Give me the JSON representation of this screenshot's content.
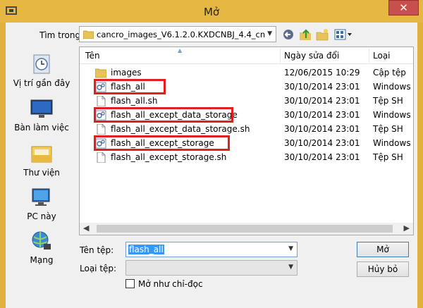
{
  "window": {
    "title": "Mở",
    "close_label": "✕"
  },
  "toolbar": {
    "look_in_label": "Tìm trong:",
    "path": "cancro_images_V6.1.2.0.KXDCNBJ_4.4_cn"
  },
  "places": [
    {
      "label": "Vị trí gần đây",
      "icon": "recent-places-icon"
    },
    {
      "label": "Bàn làm việc",
      "icon": "desktop-icon"
    },
    {
      "label": "Thư viện",
      "icon": "libraries-icon"
    },
    {
      "label": "PC này",
      "icon": "this-pc-icon"
    },
    {
      "label": "Mạng",
      "icon": "network-icon"
    }
  ],
  "columns": {
    "name": "Tên",
    "date": "Ngày sửa đổi",
    "type": "Loại"
  },
  "files": [
    {
      "name": "images",
      "date": "12/06/2015 10:29",
      "type": "Cập tệp",
      "icon": "folder-icon",
      "highlighted": false
    },
    {
      "name": "flash_all",
      "date": "30/10/2014 23:01",
      "type": "Windows",
      "icon": "batch-file-icon",
      "highlighted": true
    },
    {
      "name": "flash_all.sh",
      "date": "30/10/2014 23:01",
      "type": "Tệp SH",
      "icon": "document-icon",
      "highlighted": false
    },
    {
      "name": "flash_all_except_data_storage",
      "date": "30/10/2014 23:01",
      "type": "Windows",
      "icon": "batch-file-icon",
      "highlighted": true
    },
    {
      "name": "flash_all_except_data_storage.sh",
      "date": "30/10/2014 23:01",
      "type": "Tệp SH",
      "icon": "document-icon",
      "highlighted": false
    },
    {
      "name": "flash_all_except_storage",
      "date": "30/10/2014 23:01",
      "type": "Windows",
      "icon": "batch-file-icon",
      "highlighted": true
    },
    {
      "name": "flash_all_except_storage.sh",
      "date": "30/10/2014 23:01",
      "type": "Tệp SH",
      "icon": "document-icon",
      "highlighted": false
    }
  ],
  "form": {
    "filename_label": "Tên tệp:",
    "filename_value": "flash_all",
    "filetype_label": "Loại tệp:",
    "filetype_value": "",
    "readonly_label": "Mở như chỉ-đọc",
    "open_button": "Mở",
    "cancel_button": "Hủy bỏ"
  },
  "colors": {
    "title_bar": "#e6b843",
    "close": "#c74f4c",
    "highlight_box": "#e0201c",
    "selection": "#3399ff"
  }
}
